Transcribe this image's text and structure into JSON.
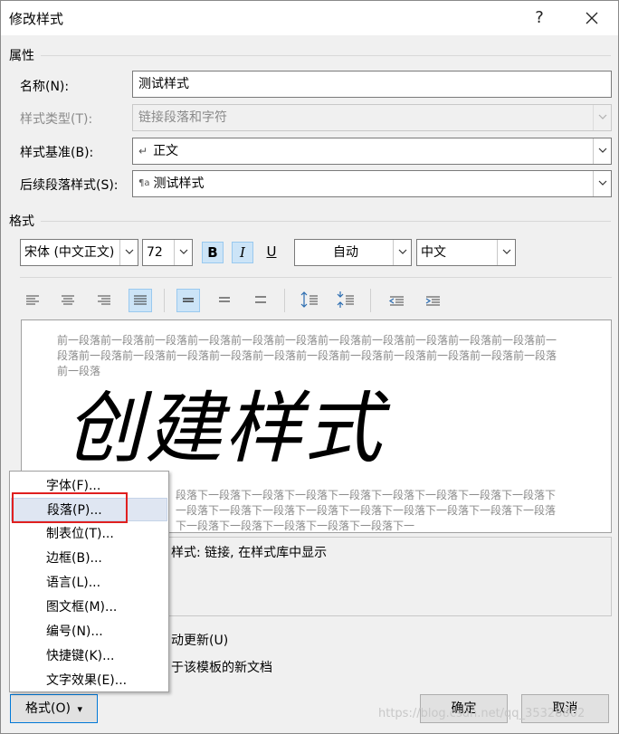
{
  "dialog": {
    "title": "修改样式",
    "help_glyph": "?",
    "close_glyph": "✕"
  },
  "properties": {
    "section_label": "属性",
    "name_label": "名称(N):",
    "name_value": "测试样式",
    "style_type_label": "样式类型(T):",
    "style_type_value": "链接段落和字符",
    "based_on_label": "样式基准(B):",
    "based_on_value": "正文",
    "based_on_icon": "↵",
    "next_style_label": "后续段落样式(S):",
    "next_style_value": "测试样式",
    "next_style_icon": "¶a"
  },
  "format": {
    "section_label": "格式",
    "font_name": "宋体 (中文正文)",
    "font_size": "72",
    "bold": "B",
    "italic": "I",
    "underline": "U",
    "color": "自动",
    "language": "中文",
    "bold_active": true,
    "italic_active": true,
    "alignment_selected": "justify",
    "line_spacing_selected": "single"
  },
  "preview": {
    "before_text": "前一段落前一段落前一段落前一段落前一段落前一段落前一段落前一段落前一段落前一段落前一段落前一段落前一段落前一段落前一段落前一段落前一段落前一段落前一段落前一段落前一段落前一段落前一段落前一段落",
    "sample_text": "创建样式",
    "after_text": "段落下一段落下一段落下一段落下一段落下一段落下一段落下一段落下一段落下一段落下一段落下一段落下一段落下一段落下一段落下一段落下一段落下一段落下一段落下一段落下一段落下一段落下一段落下一"
  },
  "description": {
    "text": "样式: 链接, 在样式库中显示"
  },
  "options": {
    "auto_update_label": "动更新(U)",
    "new_docs_label": "于该模板的新文档"
  },
  "menu": {
    "items": [
      "字体(F)...",
      "段落(P)...",
      "制表位(T)...",
      "边框(B)...",
      "语言(L)...",
      "图文框(M)...",
      "编号(N)...",
      "快捷键(K)...",
      "文字效果(E)..."
    ],
    "highlighted_index": 1
  },
  "buttons": {
    "format_label": "格式(O)",
    "format_caret": "▾",
    "ok_label": "确定",
    "cancel_label": "取消"
  },
  "watermark": "https://blog.csdn.net/qq_35328802",
  "colors": {
    "dialog_bg": "#f0f0f0",
    "toggle_active": "#cce4f7",
    "highlight_box": "#e02020",
    "menu_hover": "#dfe6f2"
  }
}
